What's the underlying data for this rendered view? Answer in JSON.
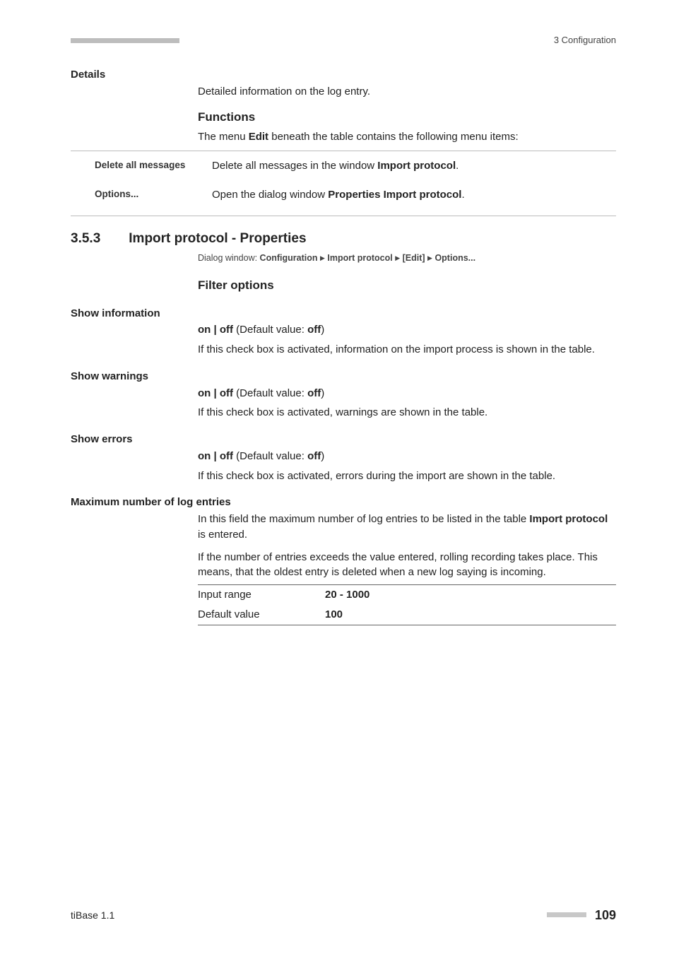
{
  "header": {
    "right": "3 Configuration"
  },
  "details": {
    "term": "Details",
    "text": "Detailed information on the log entry."
  },
  "functions": {
    "heading": "Functions",
    "intro_pre": "The menu ",
    "intro_bold": "Edit",
    "intro_post": " beneath the table contains the following menu items:",
    "rows": [
      {
        "label": "Delete all messages",
        "desc_pre": "Delete all messages in the window ",
        "desc_bold": "Import protocol",
        "desc_post": "."
      },
      {
        "label": "Options...",
        "desc_pre": "Open the dialog window ",
        "desc_bold": "Properties Import protocol",
        "desc_post": "."
      }
    ]
  },
  "section": {
    "num": "3.5.3",
    "title": "Import protocol - Properties",
    "path_label": "Dialog window: ",
    "path_parts": [
      "Configuration",
      "Import protocol",
      "[Edit]",
      "Options..."
    ]
  },
  "filter": {
    "heading": "Filter options",
    "items": [
      {
        "term": "Show information",
        "onoff_pre": "on | off",
        "onoff_mid": " (Default value: ",
        "onoff_val": "off",
        "onoff_post": ")",
        "desc": "If this check box is activated, information on the import process is shown in the table."
      },
      {
        "term": "Show warnings",
        "onoff_pre": "on | off",
        "onoff_mid": " (Default value: ",
        "onoff_val": "off",
        "onoff_post": ")",
        "desc": "If this check box is activated, warnings are shown in the table."
      },
      {
        "term": "Show errors",
        "onoff_pre": "on | off",
        "onoff_mid": " (Default value: ",
        "onoff_val": "off",
        "onoff_post": ")",
        "desc": "If this check box is activated, errors during the import are shown in the table."
      }
    ]
  },
  "maxlog": {
    "term": "Maximum number of log entries",
    "p1_pre": "In this field the maximum number of log entries to be listed in the table ",
    "p1_bold": "Import protocol",
    "p1_post": " is entered.",
    "p2": "If the number of entries exceeds the value entered, rolling recording takes place. This means, that the oldest entry is deleted when a new log saying is incoming.",
    "range_label": "Input range",
    "range_value": "20 - 1000",
    "default_label": "Default value",
    "default_value": "100"
  },
  "footer": {
    "left": "tiBase 1.1",
    "page": "109"
  }
}
